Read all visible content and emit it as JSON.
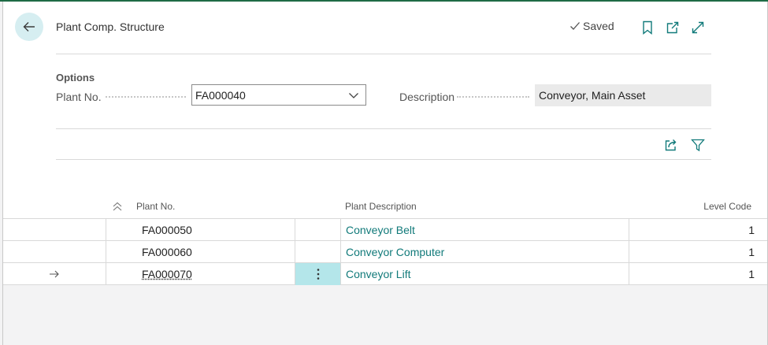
{
  "header": {
    "title": "Plant Comp. Structure",
    "saved_label": "Saved",
    "icons": [
      "back-arrow-icon",
      "checkmark-icon",
      "bookmark-icon",
      "open-in-new-window-icon",
      "expand-icon"
    ]
  },
  "options": {
    "section_title": "Options",
    "plant_no_label": "Plant No.",
    "plant_no_value": "FA000040",
    "description_label": "Description",
    "description_value": "Conveyor, Main Asset"
  },
  "toolbar": {
    "icons": [
      "share-icon",
      "filter-icon"
    ]
  },
  "table": {
    "columns": {
      "plant_no": "Plant No.",
      "plant_description": "Plant Description",
      "level_code": "Level Code"
    },
    "rows": [
      {
        "plant_no": "FA000050",
        "description": "Conveyor Belt",
        "level": "1"
      },
      {
        "plant_no": "FA000060",
        "description": "Conveyor Computer",
        "level": "1"
      },
      {
        "plant_no": "FA000070",
        "description": "Conveyor Lift",
        "level": "1"
      }
    ],
    "current_row": 3
  },
  "colors": {
    "accent": "#117a7a",
    "back_button_bg": "#d6eef1",
    "selected_cell": "#b4e6ea",
    "top_border": "#1e6b45"
  }
}
